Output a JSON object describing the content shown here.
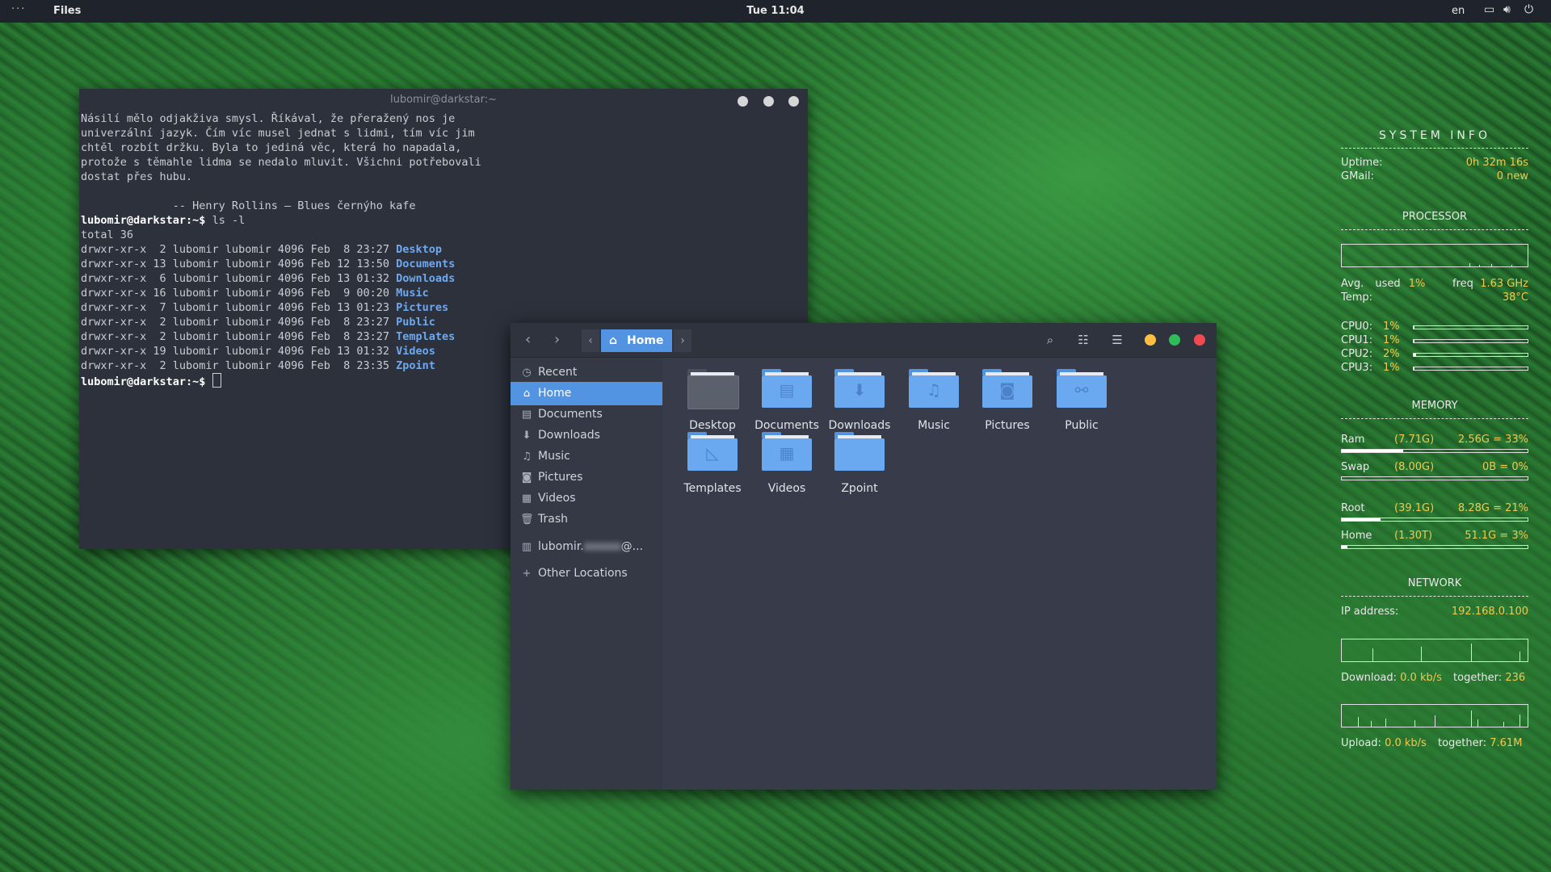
{
  "topbar": {
    "activities": "···",
    "app_name": "Files",
    "clock": "Tue 11:04",
    "language": "en"
  },
  "terminal": {
    "title": "lubomir@darkstar:~",
    "quote_lines": [
      "Násilí mělo odjakživa smysl. Říkával, že přeražený nos je",
      "univerzální jazyk. Čím víc musel jednat s lidmi, tím víc jim",
      "chtěl rozbít držku. Byla to jediná věc, která ho napadala,",
      "protože s těmahle lidma se nedalo mluvit. Všichni potřebovali",
      "dostat přes hubu."
    ],
    "attribution": "              -- Henry Rollins — Blues černýho kafe",
    "prompt": "lubomir@darkstar",
    "prompt_suffix": ":~$ ",
    "command": "ls -l",
    "total": "total 36",
    "listing": [
      {
        "perm": "drwxr-xr-x  2 lubomir lubomir 4096 Feb  8 23:27 ",
        "name": "Desktop"
      },
      {
        "perm": "drwxr-xr-x 13 lubomir lubomir 4096 Feb 12 13:50 ",
        "name": "Documents"
      },
      {
        "perm": "drwxr-xr-x  6 lubomir lubomir 4096 Feb 13 01:32 ",
        "name": "Downloads"
      },
      {
        "perm": "drwxr-xr-x 16 lubomir lubomir 4096 Feb  9 00:20 ",
        "name": "Music"
      },
      {
        "perm": "drwxr-xr-x  7 lubomir lubomir 4096 Feb 13 01:23 ",
        "name": "Pictures"
      },
      {
        "perm": "drwxr-xr-x  2 lubomir lubomir 4096 Feb  8 23:27 ",
        "name": "Public"
      },
      {
        "perm": "drwxr-xr-x  2 lubomir lubomir 4096 Feb  8 23:27 ",
        "name": "Templates"
      },
      {
        "perm": "drwxr-xr-x 19 lubomir lubomir 4096 Feb 13 01:32 ",
        "name": "Videos"
      },
      {
        "perm": "drwxr-xr-x  2 lubomir lubomir 4096 Feb  8 23:35 ",
        "name": "Zpoint"
      }
    ]
  },
  "files": {
    "path_current": "Home",
    "sidebar": [
      {
        "label": "Recent",
        "icon": "clock-icon"
      },
      {
        "label": "Home",
        "icon": "home-icon",
        "active": true
      },
      {
        "label": "Documents",
        "icon": "document-icon"
      },
      {
        "label": "Downloads",
        "icon": "download-icon"
      },
      {
        "label": "Music",
        "icon": "music-icon"
      },
      {
        "label": "Pictures",
        "icon": "camera-icon"
      },
      {
        "label": "Videos",
        "icon": "film-icon"
      },
      {
        "label": "Trash",
        "icon": "trash-icon"
      },
      {
        "label": "lubomir.",
        "label_suffix": "@...",
        "icon": "drive-icon"
      },
      {
        "label": "Other Locations",
        "icon": "plus-icon"
      }
    ],
    "folders": [
      {
        "name": "Desktop"
      },
      {
        "name": "Documents"
      },
      {
        "name": "Downloads"
      },
      {
        "name": "Music"
      },
      {
        "name": "Pictures"
      },
      {
        "name": "Public"
      },
      {
        "name": "Templates"
      },
      {
        "name": "Videos"
      },
      {
        "name": "Zpoint"
      }
    ]
  },
  "conky": {
    "title": "SYSTEM INFO",
    "uptime_label": "Uptime:",
    "uptime": "0h 32m 16s",
    "gmail_label": "GMail:",
    "gmail": "0 new",
    "processor_head": "PROCESSOR",
    "avg_label": "Avg.",
    "used_label": "used",
    "avg_used": "1%",
    "freq_label": "freq",
    "freq": "1.63 GHz",
    "temp_label": "Temp:",
    "temp": "38°C",
    "cpus": [
      {
        "label": "CPU0:",
        "value": "1%",
        "level": 0.01
      },
      {
        "label": "CPU1:",
        "value": "1%",
        "level": 0.01
      },
      {
        "label": "CPU2:",
        "value": "2%",
        "level": 0.02
      },
      {
        "label": "CPU3:",
        "value": "1%",
        "level": 0.01
      }
    ],
    "memory_head": "MEMORY",
    "ram_label": "Ram",
    "ram_total": "(7.71G)",
    "ram_used": "2.56G = 33%",
    "ram_level": 0.33,
    "swap_label": "Swap",
    "swap_total": "(8.00G)",
    "swap_used": "0B = 0%",
    "swap_level": 0.0,
    "root_label": "Root",
    "root_total": "(39.1G)",
    "root_used": "8.28G = 21%",
    "root_level": 0.21,
    "home_label": "Home",
    "home_total": "(1.30T)",
    "home_used": "51.1G = 3%",
    "home_level": 0.03,
    "network_head": "NETWORK",
    "ip_label": "IP address:",
    "ip": "192.168.0.100",
    "download_label": "Download:",
    "download": "0.0 kb/s",
    "down_together_label": "together:",
    "down_together": "236",
    "upload_label": "Upload:",
    "upload": "0.0 kb/s",
    "up_together_label": "together:",
    "up_together": "7.61M"
  }
}
